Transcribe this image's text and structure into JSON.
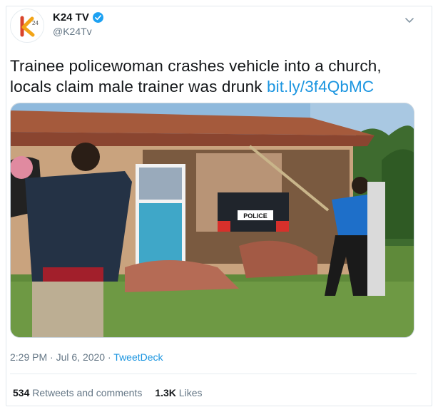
{
  "account": {
    "display_name": "K24 TV",
    "handle": "@K24Tv",
    "avatar_icon": "k24-logo",
    "verified_icon": "verified-badge-icon",
    "verified_color": "#1da1f2"
  },
  "tweet": {
    "text": "Trainee policewoman crashes vehicle into a church, locals claim male trainer was drunk ",
    "link": "bit.ly/3f4QbMC",
    "link_color": "#1b95e0"
  },
  "media": {
    "plate_text": "POLICE"
  },
  "meta": {
    "time": "2:29 PM",
    "separator": " · ",
    "date": "Jul 6, 2020",
    "separator2": " · ",
    "source": "TweetDeck"
  },
  "stats": {
    "retweets_count": "534",
    "retweets_label": "Retweets and comments",
    "likes_count": "1.3K",
    "likes_label": "Likes"
  }
}
